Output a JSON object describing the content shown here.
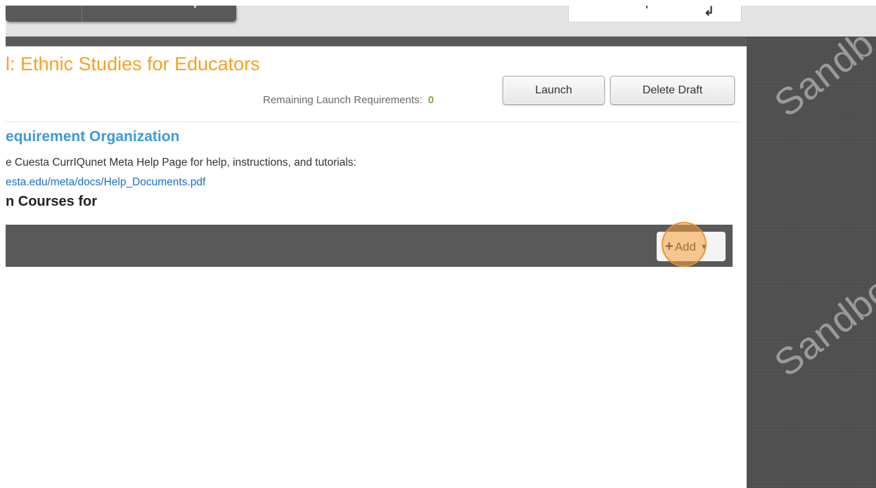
{
  "page": {
    "title": "l: Ethnic Studies for Educators",
    "remaining_label": "Remaining Launch Requirements:",
    "remaining_count": "0",
    "launch_label": "Launch",
    "delete_label": "Delete Draft"
  },
  "section": {
    "title": "equirement Organization",
    "help_text": "e Cuesta CurrIQunet Meta Help Page for help, instructions, and tutorials:",
    "help_link": "esta.edu/meta/docs/Help_Documents.pdf",
    "courses_heading": "n Courses for"
  },
  "toolbar": {
    "add_label": "Add"
  },
  "watermark": {
    "text_1": "Sandb",
    "text_2": "Sandbo"
  },
  "icons": {
    "add": "plus-icon",
    "dropdown": "caret-down-icon",
    "user_menu": "user-menu-icon"
  },
  "colors": {
    "title": "#f5a21f",
    "section_title": "#3d9bd6",
    "link": "#1a6fc6",
    "count": "#77ac3a",
    "toolbar": "#595959",
    "click_highlight": "#f5a03c"
  }
}
